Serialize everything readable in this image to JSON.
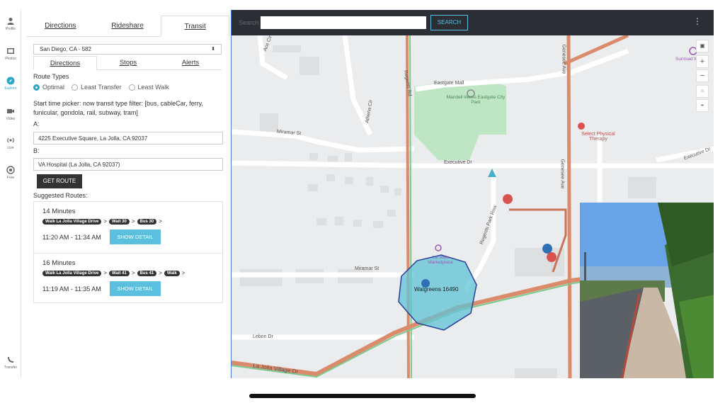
{
  "rail": {
    "items": [
      {
        "label": "Profile",
        "icon": "person-icon"
      },
      {
        "label": "Photos",
        "icon": "photos-icon"
      },
      {
        "label": "Explore",
        "icon": "compass-icon"
      },
      {
        "label": "Video",
        "icon": "video-icon"
      },
      {
        "label": "Live",
        "icon": "live-icon"
      },
      {
        "label": "Free",
        "icon": "free-icon"
      },
      {
        "label": "Transfer",
        "icon": "transfer-icon"
      }
    ],
    "active": "Explore"
  },
  "panel": {
    "top_tabs": [
      "Directions",
      "Rideshare",
      "Transit"
    ],
    "active_top_tab": "Transit",
    "city_select": "San Diego, CA - 582",
    "sub_tabs": [
      "Directions",
      "Stops",
      "Alerts"
    ],
    "active_sub_tab": "Directions",
    "route_types_label": "Route Types",
    "route_types": [
      "Optimal",
      "Least Transfer",
      "Least Walk"
    ],
    "selected_route_type": "Optimal",
    "note": "Start time picker: now transit type filter: [bus, cableCar, ferry, funicular, gondola, rail, subway, tram]",
    "a_label": "A:",
    "a_value": "4225 Executive Square, La Jolla, CA 92037",
    "b_label": "B:",
    "b_value": "VA Hospital (La Jolla, CA 92037)",
    "get_route": "GET ROUTE",
    "suggested_label": "Suggested Routes:",
    "routes": [
      {
        "minutes": "14 Minutes",
        "steps": [
          "Walk La Jolla Village Drive",
          "Wait 30",
          "Bus 30"
        ],
        "time": "11:20 AM - 11:34 AM",
        "detail": "SHOW DETAIL"
      },
      {
        "minutes": "16 Minutes",
        "steps": [
          "Walk La Jolla Village Drive",
          "Wait 41",
          "Bus 41",
          "Walk"
        ],
        "time": "11:19 AM - 11:35 AM",
        "detail": "SHOW DETAIL"
      }
    ]
  },
  "map": {
    "search_label": "Search",
    "search_value": "",
    "search_button": "SEARCH",
    "labels": {
      "eastgate_mall": "Eastgate Mall",
      "park": "Mandell Weiss Eastgate City Park",
      "miramar_st_top": "Miramar St",
      "miramar_st_bottom": "Miramar St",
      "executive_dr": "Executive Dr",
      "executive_dr_right": "Executive Dr",
      "athena_cir": "Athena Cir",
      "regents_rd": "Regents Rd",
      "regents_park_row": "Regents Park Row",
      "genesee_ave": "Genesee Ave",
      "select_therapy": "Select Physical Therapy",
      "sunroad": "Sunroad Mall Pl",
      "marketplace": "La Jolla Marketplace",
      "walgreens": "Walgreens 16490",
      "lebon_dr": "Lebon Dr",
      "la_jolla_village_dr": "La Jolla Village Dr",
      "ace_cir": "Ace Cir"
    },
    "controls": [
      "+",
      "−"
    ]
  }
}
